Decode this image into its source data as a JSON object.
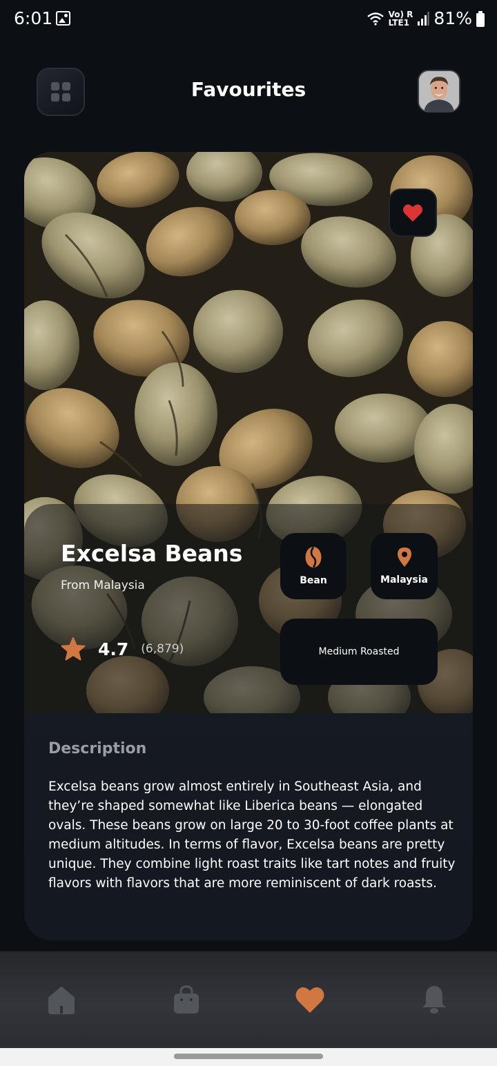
{
  "status_bar": {
    "time": "6:01",
    "signal_text": "Vo) R\nLTE1",
    "battery": "81%"
  },
  "header": {
    "title": "Favourites",
    "menu_icon": "grid-icon",
    "avatar": "avatar"
  },
  "card": {
    "name": "Excelsa Beans",
    "origin_line": "From Malaysia",
    "rating": "4.7",
    "rating_count": "(6,879)",
    "chips": {
      "type_label": "Bean",
      "origin_label": "Malaysia",
      "roast_label": "Medium Roasted"
    },
    "description_title": "Description",
    "description": "Excelsa beans grow almost entirely in Southeast Asia, and they’re shaped somewhat like Liberica beans — elongated ovals. These beans grow on large 20 to 30-foot coffee plants at medium altitudes. In terms of flavor, Excelsa beans are pretty unique. They combine light roast traits like tart notes and fruity flavors with flavors that are more reminiscent of dark roasts.",
    "favourite": true
  },
  "bottom_nav": {
    "items": [
      {
        "icon": "home-icon",
        "active": false
      },
      {
        "icon": "shopping-bag-icon",
        "active": false
      },
      {
        "icon": "heart-icon",
        "active": true
      },
      {
        "icon": "bell-icon",
        "active": false
      }
    ]
  },
  "colors": {
    "accent": "#d17842",
    "background": "#0c0f14",
    "heart_red": "#dc3535",
    "inactive_icon": "#52555a"
  }
}
